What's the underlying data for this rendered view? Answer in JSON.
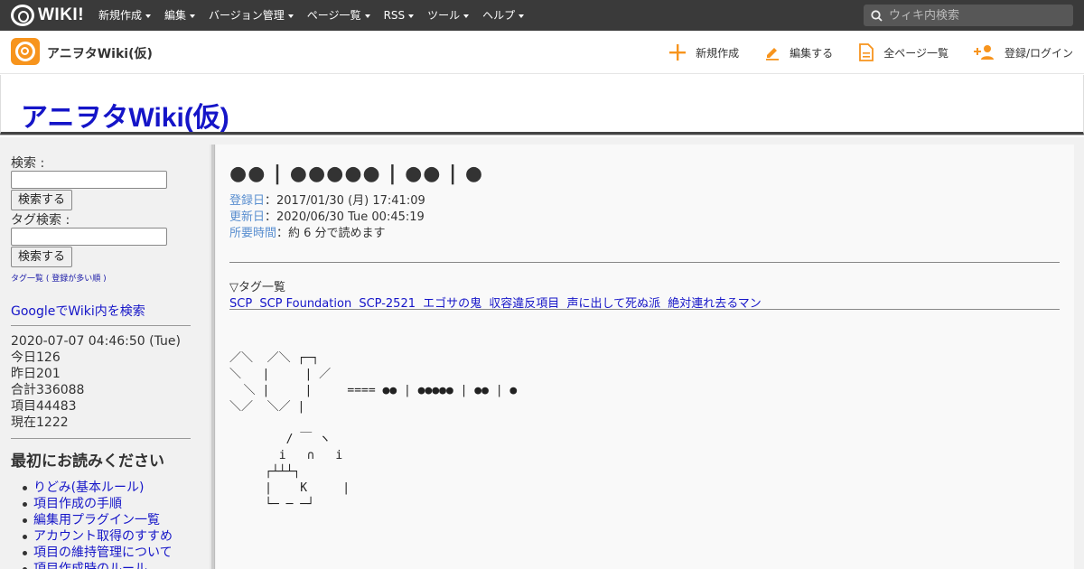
{
  "topnav": {
    "logo_text": "WIKI!",
    "menu": [
      {
        "label": "新規作成"
      },
      {
        "label": "編集"
      },
      {
        "label": "バージョン管理"
      },
      {
        "label": "ページ一覧"
      },
      {
        "label": "RSS"
      },
      {
        "label": "ツール"
      },
      {
        "label": "ヘルプ"
      }
    ],
    "search_placeholder": "ウィキ内検索"
  },
  "subbar": {
    "wiki_name": "アニヲタWiki(仮)",
    "actions": [
      {
        "label": "新規作成",
        "icon": "plus-icon",
        "color": "#f7941d"
      },
      {
        "label": "編集する",
        "icon": "pencil-icon",
        "color": "#f7941d"
      },
      {
        "label": "全ページ一覧",
        "icon": "document-icon",
        "color": "#f7941d"
      },
      {
        "label": "登録/ログイン",
        "icon": "add-user-icon",
        "color": "#f7941d"
      }
    ]
  },
  "site_title": "アニヲタWiki(仮)",
  "sidebar": {
    "search_label": "検索 :",
    "search_button": "検索する",
    "tag_search_label": "タグ検索 :",
    "tag_search_button": "検索する",
    "tag_links": "タグ一覧 ( 登録が多い順 )",
    "google_link": "GoogleでWiki内を検索",
    "datetime": "2020-07-07 04:46:50 (Tue)",
    "stats": [
      "今日126",
      "昨日201",
      "合計336088",
      "項目44483",
      "現在1222"
    ],
    "heading": "最初にお読みください",
    "links": [
      "りどみ(基本ルール)",
      "項目作成の手順",
      "編集用プラグイン一覧",
      "アカウント取得のすすめ",
      "項目の維持管理について",
      "項目作成時のルール"
    ]
  },
  "main": {
    "page_title": "●● | ●●●●● | ●● | ●",
    "registered_key": "登録日",
    "registered_val": "：2017/01/30 (月) 17:41:09",
    "updated_key": "更新日",
    "updated_val": "：2020/06/30 Tue 00:45:19",
    "readtime_key": "所要時間",
    "readtime_val": "：約 6 分で読めます",
    "tag_heading": "▽タグ一覧",
    "tags": [
      "SCP",
      "SCP Foundation",
      "SCP-2521",
      "エゴサの鬼",
      "収容違反項目",
      "声に出して死ぬ派",
      "絶対連れ去るマン"
    ],
    "ascii_art_1": "／＼  ／＼ ┌─┐\n＼   |     | ／\n  ＼ |     |     ==== ●● | ●●●●● | ●● | ●\n＼／  ＼／ |",
    "ascii_art_2": "        / ￣ ヽ\n       i   ∩   i\n     ┌┴┴┴┐\n     |    K     |\n     └─ ─ ─┘"
  }
}
